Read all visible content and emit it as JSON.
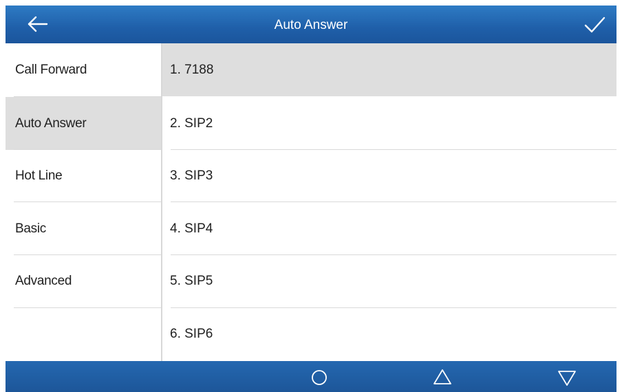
{
  "header": {
    "title": "Auto Answer",
    "back_icon": "arrow-left-icon",
    "confirm_icon": "checkmark-icon"
  },
  "sidebar": {
    "items": [
      {
        "label": "Call Forward",
        "active": false
      },
      {
        "label": "Auto Answer",
        "active": true
      },
      {
        "label": "Hot Line",
        "active": false
      },
      {
        "label": "Basic",
        "active": false
      },
      {
        "label": "Advanced",
        "active": false
      }
    ]
  },
  "list": {
    "items": [
      {
        "label": "1. 7188",
        "selected": true
      },
      {
        "label": "2. SIP2",
        "selected": false
      },
      {
        "label": "3. SIP3",
        "selected": false
      },
      {
        "label": "4. SIP4",
        "selected": false
      },
      {
        "label": "5. SIP5",
        "selected": false
      },
      {
        "label": "6. SIP6",
        "selected": false
      }
    ]
  },
  "footer": {
    "buttons": [
      {
        "name": "home-circle-icon"
      },
      {
        "name": "triangle-up-icon"
      },
      {
        "name": "triangle-down-icon"
      }
    ]
  },
  "colors": {
    "header_bg": "#1f5fa9",
    "footer_bg": "#1d5699",
    "selected_bg": "#dedede",
    "divider": "#d9d9d9",
    "text": "#222222"
  }
}
